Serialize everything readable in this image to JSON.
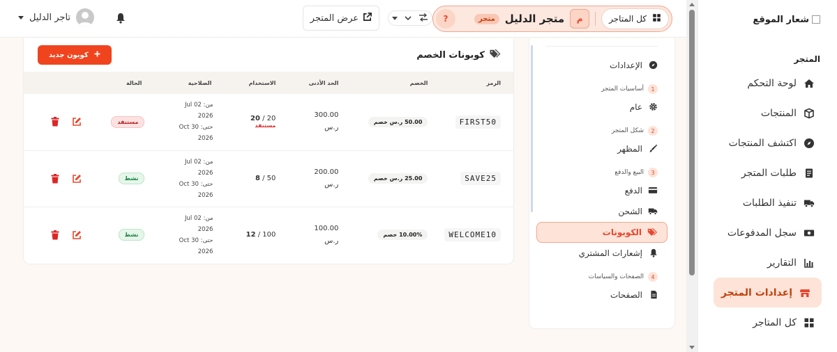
{
  "sidebar": {
    "logo_alt": "شعار الموقع",
    "section": "المتجر",
    "items": [
      {
        "label": "لوحة التحكم",
        "icon": "home-icon"
      },
      {
        "label": "المنتجات",
        "icon": "box-icon"
      },
      {
        "label": "اكتشف المنتجات",
        "icon": "compass-icon"
      },
      {
        "label": "طلبات المتجر",
        "icon": "receipt-icon"
      },
      {
        "label": "تنفيذ الطلبات",
        "icon": "truck-icon"
      },
      {
        "label": "سجل المدفوعات",
        "icon": "money-icon"
      },
      {
        "label": "التقارير",
        "icon": "chart-icon"
      },
      {
        "label": "إعدادات المتجر",
        "icon": "store-icon",
        "active": true
      },
      {
        "label": "كل المتاجر",
        "icon": "grid-icon"
      }
    ]
  },
  "topbar": {
    "all_stores": "كل المتاجر",
    "store_initial": "م",
    "store_name": "متجر الدليل",
    "store_badge": "متجر",
    "help": "?",
    "view_store": "عرض المتجر",
    "user_name": "تاجر الدليل"
  },
  "settings_nav": {
    "settings": "الإعدادات",
    "groups": [
      {
        "num": "1",
        "label": "أساسيات المتجر",
        "items": [
          "عام"
        ]
      },
      {
        "num": "2",
        "label": "شكل المتجر",
        "items": [
          "المظهر"
        ]
      },
      {
        "num": "3",
        "label": "البيع والدفع",
        "items": [
          "الدفع",
          "الشحن",
          "الكوبونات",
          "إشعارات المشتري"
        ]
      },
      {
        "num": "4",
        "label": "الصفحات والسياسات",
        "items": [
          "الصفحات"
        ]
      }
    ]
  },
  "coupons": {
    "title": "كوبونات الخصم",
    "new_button": "كوبون جديد",
    "columns": {
      "code": "الرمز",
      "discount": "الخصم",
      "min": "الحد الأدنى",
      "usage": "الاستخدام",
      "validity": "الصلاحية",
      "status": "الحالة"
    },
    "rows": [
      {
        "code": "FIRST50",
        "discount": "50.00 ر.س خصم",
        "min_amount": "300.00",
        "min_currency": "ر.س",
        "usage_used": "20",
        "usage_limit": "20 / ",
        "usage_note": "مستنفد",
        "valid_from": "من: 02 Jul",
        "valid_from_year": "2026",
        "valid_to": "حتى: 30 Oct",
        "valid_to_year": "2026",
        "status": "مستنفد",
        "status_type": "bad"
      },
      {
        "code": "SAVE25",
        "discount": "25.00 ر.س خصم",
        "min_amount": "200.00",
        "min_currency": "ر.س",
        "usage_used": "8",
        "usage_limit": "50 / ",
        "usage_note": "",
        "valid_from": "من: 02 Jul",
        "valid_from_year": "2026",
        "valid_to": "حتى: 30 Oct",
        "valid_to_year": "2026",
        "status": "نشط",
        "status_type": "ok"
      },
      {
        "code": "WELCOME10",
        "discount": "10.00% خصم",
        "min_amount": "100.00",
        "min_currency": "ر.س",
        "usage_used": "12",
        "usage_limit": "100 / ",
        "usage_note": "",
        "valid_from": "من: 02 Jul",
        "valid_from_year": "2026",
        "valid_to": "حتى: 30 Oct",
        "valid_to_year": "2026",
        "status": "نشط",
        "status_type": "ok"
      }
    ]
  },
  "colors": {
    "accent": "#f0441f",
    "accent_soft": "#fde3d8",
    "delete": "#dc2626",
    "edit": "#e8462d"
  }
}
